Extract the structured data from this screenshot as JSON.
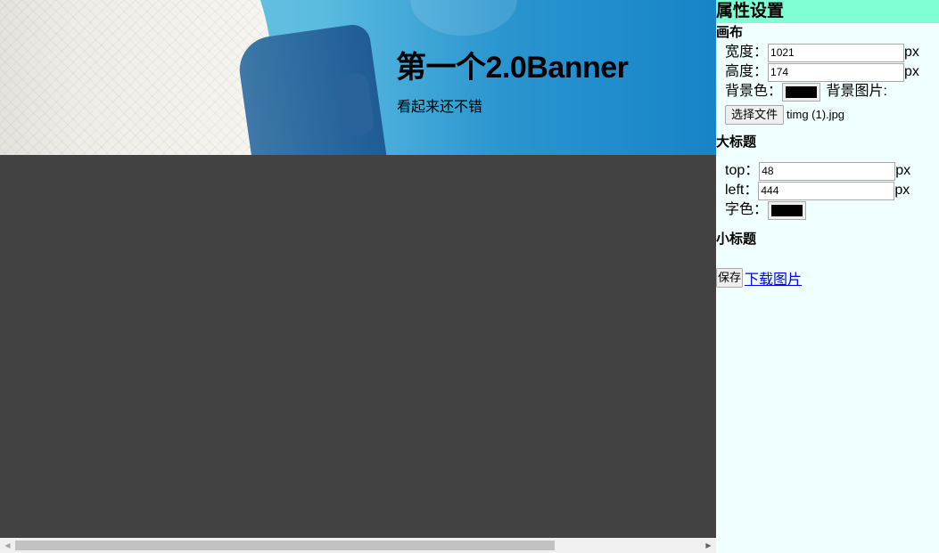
{
  "banner": {
    "title": "第一个2.0Banner",
    "subtitle": "看起来还不错"
  },
  "panel": {
    "header": "属性设置",
    "canvas": {
      "section_title": "画布",
      "width_label": "宽度：",
      "width_value": "1021",
      "height_label": "高度：",
      "height_value": "174",
      "unit": "px",
      "bgcolor_label": "背景色：",
      "bgcolor_value": "#000000",
      "bgimage_label": "背景图片:",
      "file_button": "选择文件",
      "file_name": "timg (1).jpg"
    },
    "title_section": {
      "section_title": "大标题",
      "top_label": "top：",
      "top_value": "48",
      "left_label": "left：",
      "left_value": "444",
      "unit": "px",
      "color_label": "字色：",
      "color_value": "#000000"
    },
    "subtitle_section": {
      "section_title": "小标题"
    },
    "actions": {
      "save_label": "保存",
      "download_label": "下载图片"
    }
  },
  "colors": {
    "panel_background": "#f0ffff",
    "panel_header": "#7fffd4",
    "workspace_background": "#424242",
    "link": "#0000ee"
  }
}
